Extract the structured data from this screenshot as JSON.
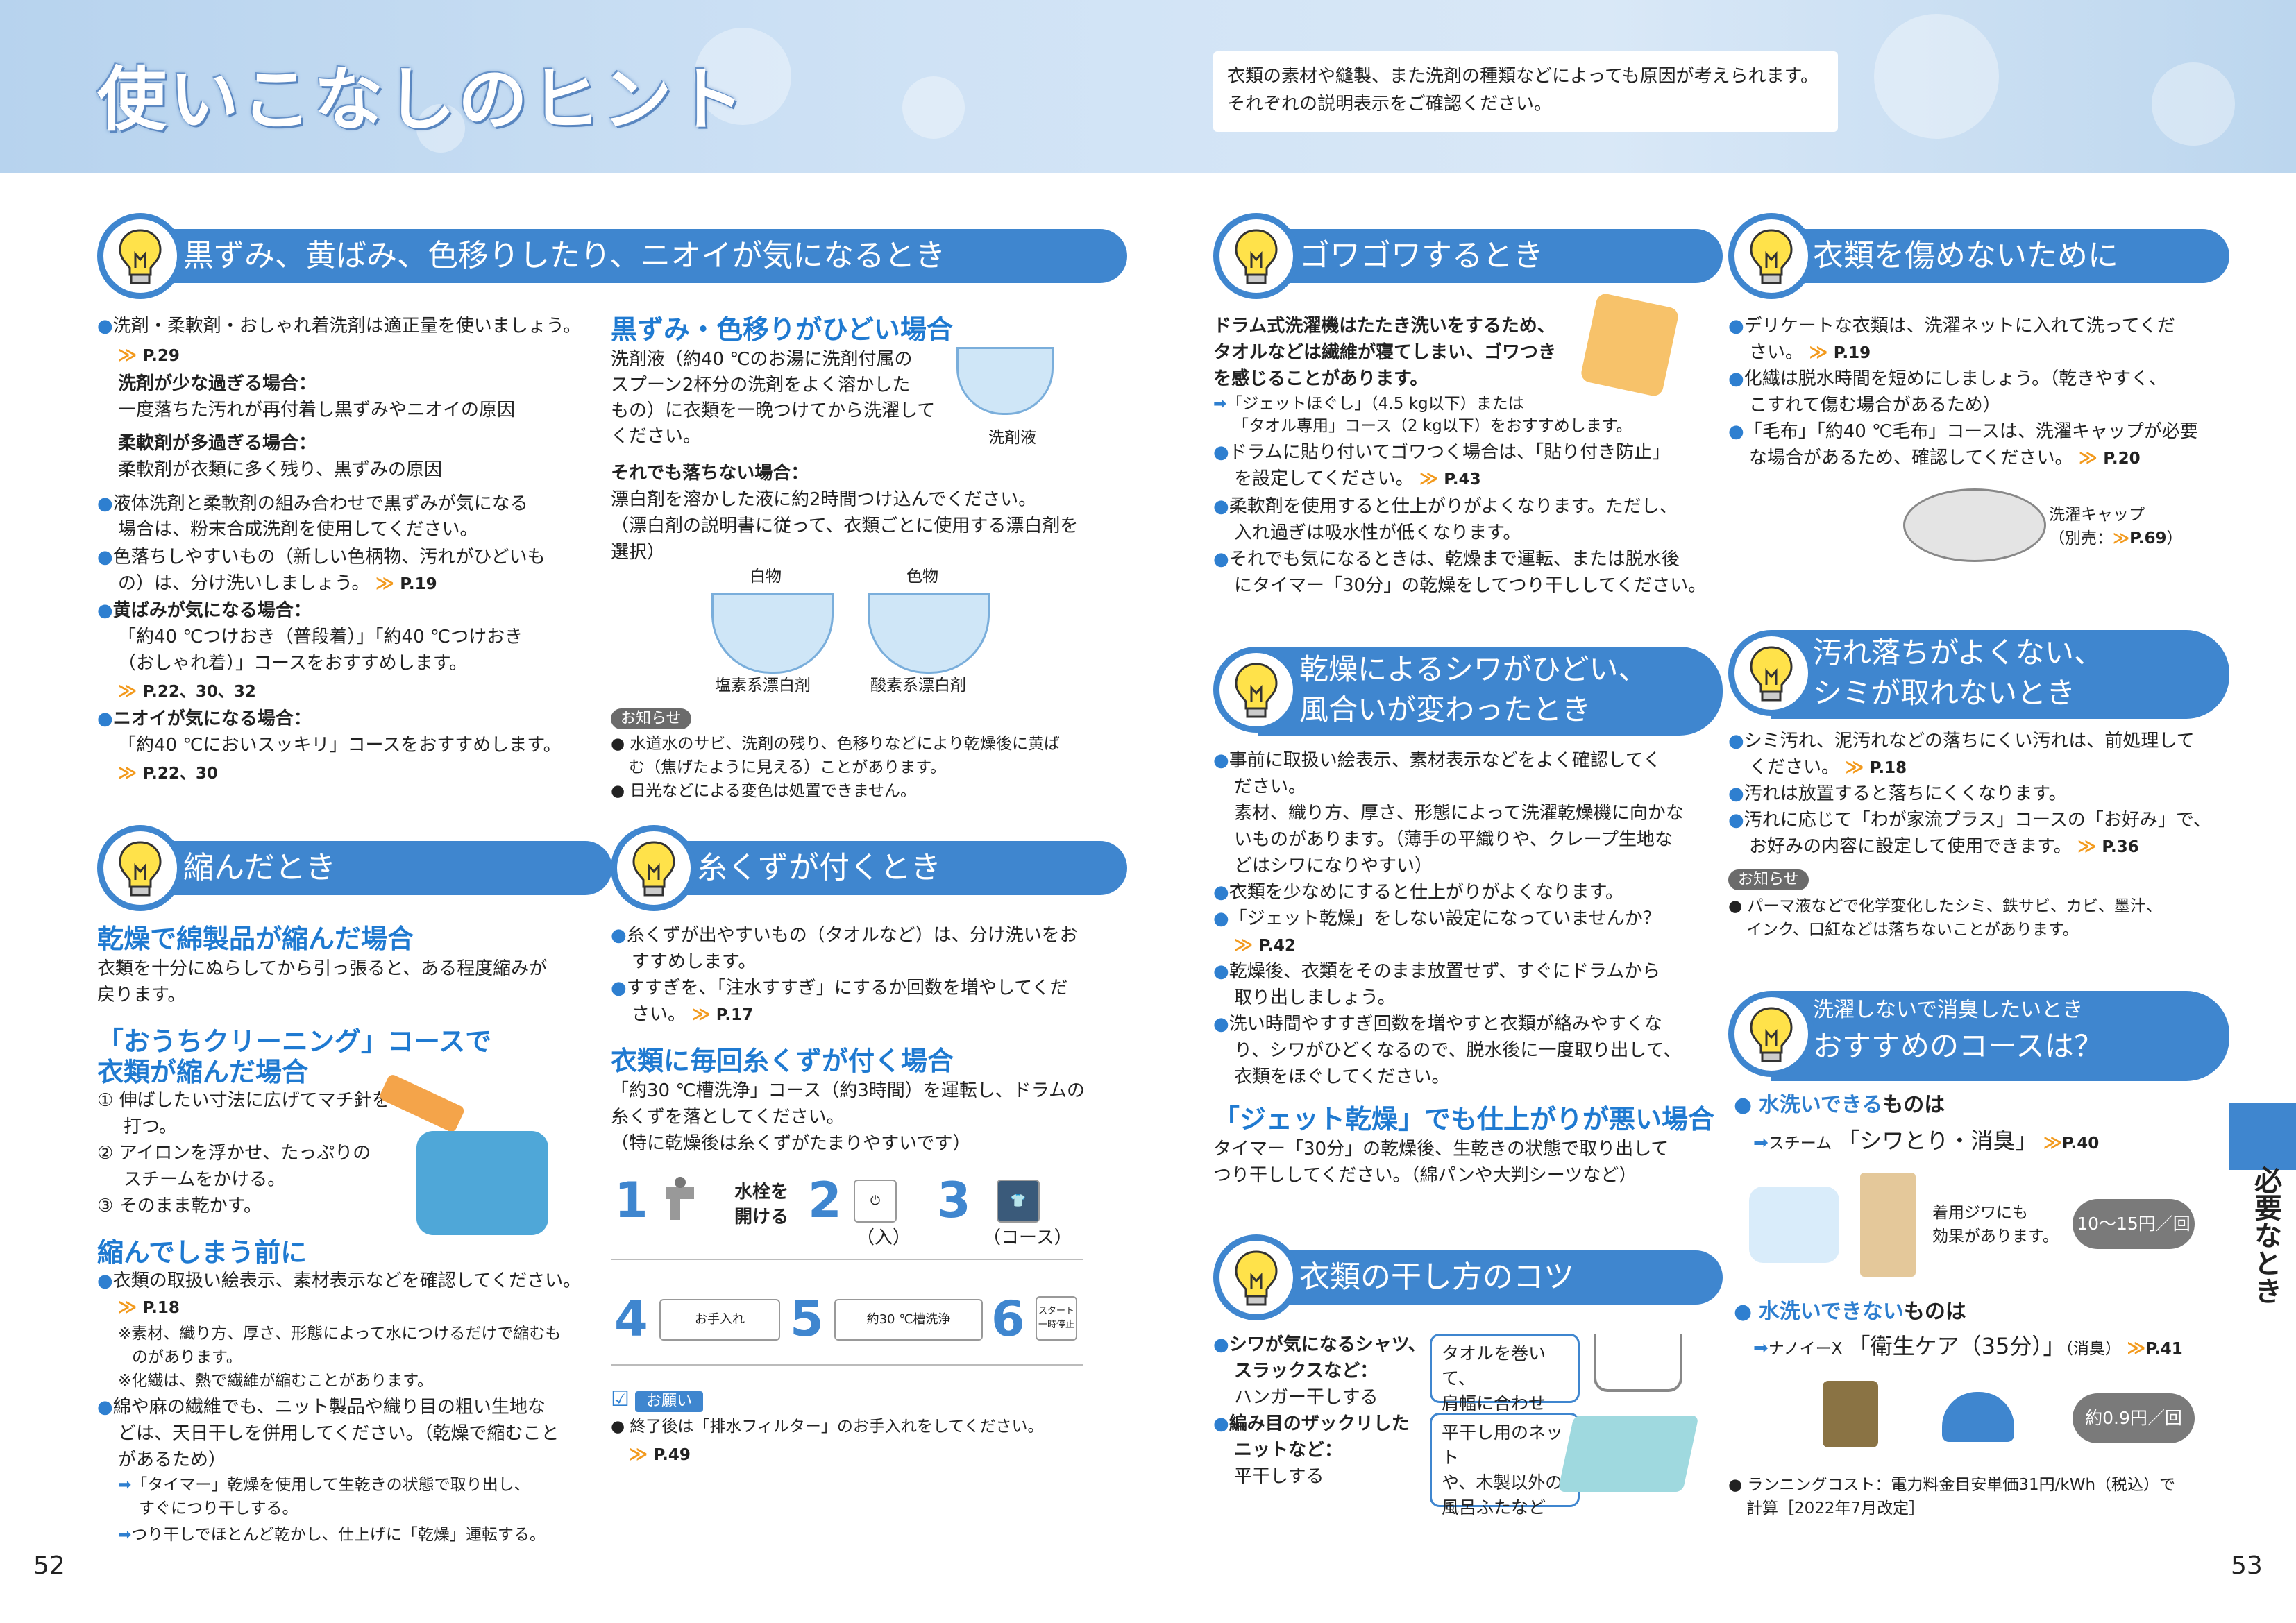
{
  "header": {
    "title": "使いこなしのヒント",
    "note_lines": [
      "衣類の素材や縫製、また洗剤の種類などによっても原因が考えられます。",
      "それぞれの説明表示をご確認ください。"
    ]
  },
  "sec_kurozumi": {
    "heading": "黒ずみ、黄ばみ、色移りしたり、ニオイが気になるとき",
    "l1": "洗剤・柔軟剤・おしゃれ着洗剤は適正量を使いましょう。",
    "r1": "P.29",
    "sub1": "洗剤が少な過ぎる場合：",
    "sub1_t": "一度落ちた汚れが再付着し黒ずみやニオイの原因",
    "sub2": "柔軟剤が多過ぎる場合：",
    "sub2_t": "柔軟剤が衣類に多く残り、黒ずみの原因",
    "l2a": "液体洗剤と柔軟剤の組み合わせで黒ずみが気になる",
    "l2b": "場合は、粉末合成洗剤を使用してください。",
    "l3a": "色落ちしやすいもの（新しい色柄物、汚れがひどいも",
    "l3b": "の）は、分け洗いしましょう。",
    "r3": "P.19",
    "l4": "黄ばみが気になる場合：",
    "l4a": "「約40 ℃つけおき（普段着）」「約40 ℃つけおき",
    "l4b": "（おしゃれ着）」コースをおすすめします。",
    "r4": "P.22、30、32",
    "l5": "ニオイが気になる場合：",
    "l5a": "「約40 ℃においスッキリ」コースをおすすめします。",
    "r5": "P.22、30"
  },
  "sec_hidoi": {
    "heading": "黒ずみ・色移りがひどい場合",
    "p1": "洗剤液（約40 ℃のお湯に洗剤付属の",
    "p2": "スプーン2杯分の洗剤をよく溶かした",
    "p3": "もの）に衣類を一晩つけてから洗濯して",
    "p4": "ください。",
    "cap": "洗剤液",
    "sub": "それでも落ちない場合：",
    "s1": "漂白剤を溶かした液に約2時間つけ込んでください。",
    "s2": "（漂白剤の説明書に従って、衣類ごとに使用する漂白剤を",
    "s3": "選択）",
    "shiro": "白物",
    "iro": "色物",
    "enso": "塩素系漂白剤",
    "sanso": "酸素系漂白剤",
    "notice": "お知らせ",
    "n1a": "水道水のサビ、洗剤の残り、色移りなどにより乾燥後に黄ば",
    "n1b": "む（焦げたように見える）ことがあります。",
    "n2": "日光などによる変色は処置できません。"
  },
  "sec_chijimi": {
    "heading": "縮んだとき",
    "h1": "乾燥で綿製品が縮んだ場合",
    "p1": "衣類を十分にぬらしてから引っ張ると、ある程度縮みが",
    "p2": "戻ります。",
    "h2a": "「おうちクリーニング」コースで",
    "h2b": "衣類が縮んだ場合",
    "st1a": "① 伸ばしたい寸法に広げてマチ針を",
    "st1b": "打つ。",
    "st2a": "② アイロンを浮かせ、たっぷりの",
    "st2b": "スチームをかける。",
    "st3": "③ そのまま乾かす。",
    "h3": "縮んでしまう前に",
    "b1": "衣類の取扱い絵表示、素材表示などを確認してください。",
    "r1": "P.18",
    "note1a": "※素材、織り方、厚さ、形態によって水につけるだけで縮むも",
    "note1b": "のがあります。",
    "note2": "※化繊は、熱で繊維が縮むことがあります。",
    "b2a": "綿や麻の繊維でも、ニット製品や織り目の粗い生地な",
    "b2b": "どは、天日干しを併用してください。（乾燥で縮むこと",
    "b2c": "があるため）",
    "a1a": "「タイマー」乾燥を使用して生乾きの状態で取り出し、",
    "a1b": "すぐにつり干しする。",
    "a2": "つり干しでほとんど乾かし、仕上げに「乾燥」運転する。"
  },
  "sec_itokuzu": {
    "heading": "糸くずが付くとき",
    "b1a": "糸くずが出やすいもの（タオルなど）は、分け洗いをお",
    "b1b": "すすめします。",
    "b2a": "すすぎを、「注水すすぎ」にするか回数を増やしてくだ",
    "b2b": "さい。",
    "r2": "P.17",
    "h1": "衣類に毎回糸くずが付く場合",
    "p1": "「約30 ℃槽洗浄」コース（約3時間）を運転し、ドラムの",
    "p2": "糸くずを落としてください。",
    "p3": "（特に乾燥後は糸くずがたまりやすいです）",
    "n1": "1",
    "s1a": "水栓を",
    "s1b": "開ける",
    "n2": "2",
    "s2": "（入）",
    "n3": "3",
    "s3": "（コース）",
    "n4": "4",
    "s4": "お手入れ",
    "n5": "5",
    "s5": "約30 ℃槽洗浄",
    "n6": "6",
    "s6a": "スタート",
    "s6b": "一時停止",
    "onegai": "お願い",
    "o1": "終了後は「排水フィルター」のお手入れをしてください。",
    "or1": "P.49"
  },
  "sec_gowa": {
    "heading": "ゴワゴワするとき",
    "p1": "ドラム式洗濯機はたたき洗いをするため、",
    "p2": "タオルなどは繊維が寝てしまい、ゴワつき",
    "p3": "を感じることがあります。",
    "a1a": "「ジェットほぐし」（4.5 kg以下）または",
    "a1b": "「タオル専用」コース（2 kg以下）をおすすめします。",
    "b1a": "ドラムに貼り付いてゴワつく場合は、「貼り付き防止」",
    "b1b": "を設定してください。",
    "r1": "P.43",
    "b2a": "柔軟剤を使用すると仕上がりがよくなります。ただし、",
    "b2b": "入れ過ぎは吸水性が低くなります。",
    "b3a": "それでも気になるときは、乾燥まで運転、または脱水後",
    "b3b": "にタイマー「30分」の乾燥をしてつり干ししてください。"
  },
  "sec_shiwa": {
    "heading1": "乾燥によるシワがひどい、",
    "heading2": "風合いが変わったとき",
    "b1a": "事前に取扱い絵表示、素材表示などをよく確認してく",
    "b1b": "ださい。",
    "b1c": "素材、織り方、厚さ、形態によって洗濯乾燥機に向かな",
    "b1d": "いものがあります。（薄手の平織りや、クレープ生地な",
    "b1e": "どはシワになりやすい）",
    "b2": "衣類を少なめにすると仕上がりがよくなります。",
    "b3": "「ジェット乾燥」をしない設定になっていませんか？",
    "r3": "P.42",
    "b4a": "乾燥後、衣類をそのまま放置せず、すぐにドラムから",
    "b4b": "取り出しましょう。",
    "b5a": "洗い時間やすすぎ回数を増やすと衣類が絡みやすくな",
    "b5b": "り、シワがひどくなるので、脱水後に一度取り出して、",
    "b5c": "衣類をほぐしてください。",
    "h1": "「ジェット乾燥」でも仕上がりが悪い場合",
    "p1": "タイマー「30分」の乾燥後、生乾きの状態で取り出して",
    "p2": "つり干ししてください。（綿パンや大判シーツなど）"
  },
  "sec_hoshi": {
    "heading": "衣類の干し方のコツ",
    "b1a": "シワが気になるシャツ、",
    "b1b": "スラックスなど：",
    "b1c": "ハンガー干しする",
    "c1a": "タオルを巻いて、",
    "c1b": "肩幅に合わせる。",
    "b2a": "編み目のザックリした",
    "b2b": "ニットなど：",
    "b2c": "平干しする",
    "c2a": "平干し用のネット",
    "c2b": "や、木製以外の",
    "c2c": "風呂ふたなど"
  },
  "sec_itamenai": {
    "heading": "衣類を傷めないために",
    "b1a": "デリケートな衣類は、洗濯ネットに入れて洗ってくだ",
    "b1b": "さい。",
    "r1": "P.19",
    "b2a": "化繊は脱水時間を短めにしましょう。（乾きやすく、",
    "b2b": "こすれて傷む場合があるため）",
    "b3a": "「毛布」「約40 ℃毛布」コースは、洗濯キャップが必要",
    "b3b": "な場合があるため、確認してください。",
    "r3": "P.20",
    "cap1": "洗濯キャップ",
    "cap2": "（別売：",
    "cap_r": "P.69",
    "cap3": "）"
  },
  "sec_yogore": {
    "heading1": "汚れ落ちがよくない、",
    "heading2": "シミが取れないとき",
    "b1a": "シミ汚れ、泥汚れなどの落ちにくい汚れは、前処理して",
    "b1b": "ください。",
    "r1": "P.18",
    "b2": "汚れは放置すると落ちにくくなります。",
    "b3a": "汚れに応じて「わが家流プラス」コースの「お好み」で、",
    "b3b": "お好みの内容に設定して使用できます。",
    "r3": "P.36",
    "notice": "お知らせ",
    "n1a": "パーマ液などで化学変化したシミ、鉄サビ、カビ、墨汁、",
    "n1b": "インク、口紅などは落ちないことがあります。"
  },
  "sec_shoshu": {
    "heading1": "洗濯しないで消臭したいとき",
    "heading2": "おすすめのコースは？",
    "w1": "水洗いできる",
    "w1s": "ものは",
    "c1pre": "スチーム",
    "c1": "「シワとり・消臭」",
    "r1": "P.40",
    "note1a": "着用ジワにも",
    "note1b": "効果があります。",
    "price1": "10〜15円／回",
    "w2": "水洗いできない",
    "w2s": "ものは",
    "c2pre": "ナノイーX",
    "c2": "「衛生ケア（35分）」",
    "c2post": "（消臭）",
    "r2": "P.41",
    "price2": "約0.9円／回",
    "rc1": "ランニングコスト：電力料金目安単価31円/kWh（税込）で",
    "rc2": "計算［2022年7月改定］"
  },
  "sidetab": "必要なとき",
  "page_left": "52",
  "page_right": "53",
  "colors": {
    "accent": "#3f86cf",
    "heading_text": "#1f7ad1",
    "ref": "#f29a1e"
  }
}
